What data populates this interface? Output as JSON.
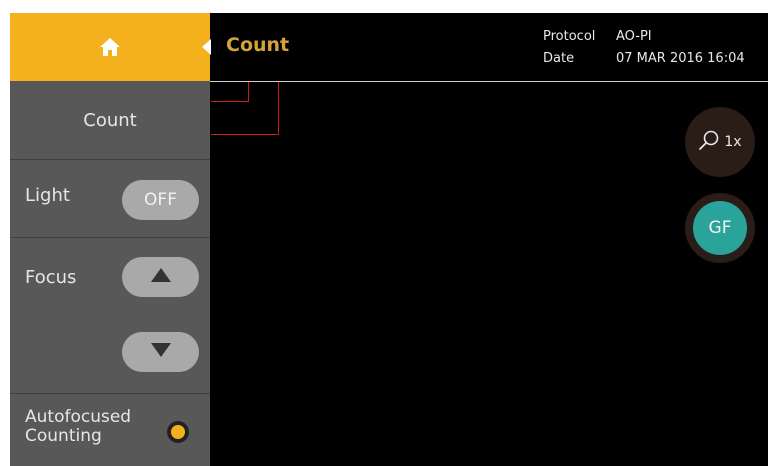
{
  "colors": {
    "accent": "#f5b01e",
    "sidebar": "#585858",
    "toggle": "#a9a9a9",
    "title": "#d4a23a",
    "roi": "#c81e1e",
    "gf": "#2aa39b"
  },
  "home": {
    "icon": "home-icon"
  },
  "sidebar": {
    "count_label": "Count",
    "light_label": "Light",
    "light_toggle": "OFF",
    "focus_label": "Focus",
    "focus_up_icon": "triangle-up-icon",
    "focus_down_icon": "triangle-down-icon",
    "autofocus_label_line1": "Autofocused",
    "autofocus_label_line2": "Counting",
    "autofocus_selected": true
  },
  "header": {
    "title": "Count",
    "protocol_key": "Protocol",
    "protocol_value": "AO-PI",
    "date_key": "Date",
    "date_value": "07 MAR 2016 16:04"
  },
  "controls": {
    "zoom_icon": "magnifier-icon",
    "zoom_level": "1x",
    "gf_label": "GF"
  }
}
